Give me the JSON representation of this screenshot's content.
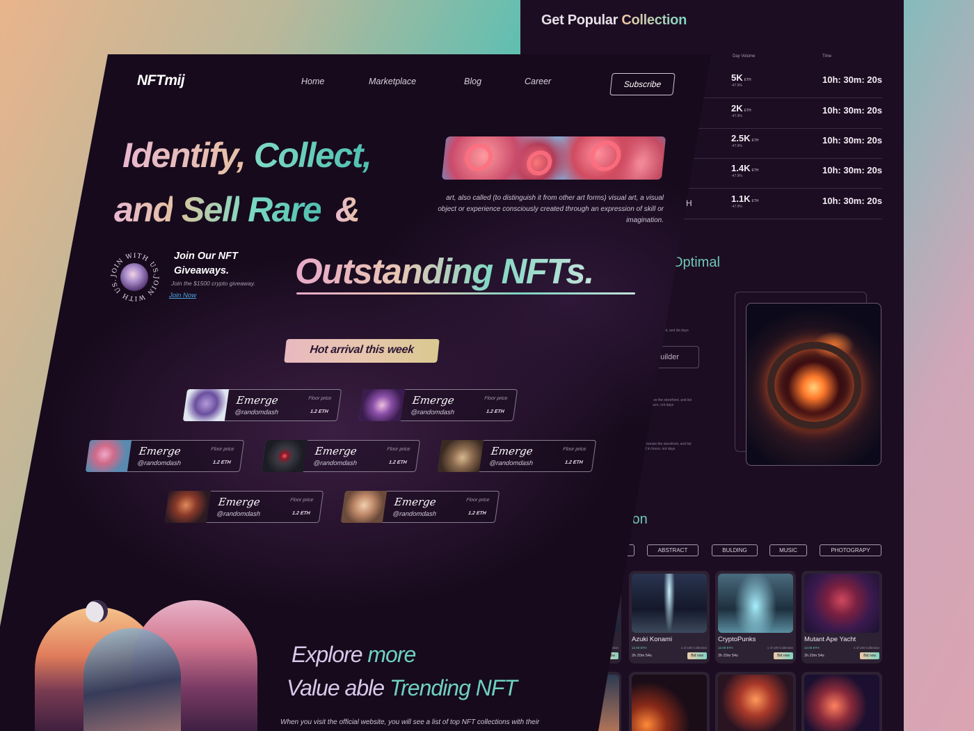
{
  "back_page": {
    "title_part1": "Get Popular",
    "title_part2": "Collection",
    "headers": [
      "Day Volume",
      "Time"
    ],
    "rows": [
      {
        "volume": "5K",
        "unit": "ETH",
        "change": "-47.9%",
        "time": "10h: 30m: 20s",
        "prefix": ""
      },
      {
        "volume": "2K",
        "unit": "ETH",
        "change": "-47.9%",
        "time": "10h: 30m: 20s",
        "prefix": ""
      },
      {
        "volume": "2.5K",
        "unit": "ETH",
        "change": "-47.9%",
        "time": "10h: 30m: 20s",
        "prefix": ""
      },
      {
        "volume": "1.4K",
        "unit": "ETH",
        "change": "-47.9%",
        "time": "10h: 30m: 20s",
        "prefix": ""
      },
      {
        "volume": "1.1K",
        "unit": "ETH",
        "change": "-47.9%",
        "time": "10h: 30m: 20s",
        "prefix": "H"
      }
    ],
    "optimal_heading": "Optimal",
    "builder_button": "builder",
    "tiny_texts": [
      "storefront, and list days",
      "mize the storefront, and list hours, not days",
      "ustomize the storefront, and list 48 in hours, not days"
    ],
    "collection_heading": "ion",
    "categories": [
      ".",
      "ABSTRACT",
      "BULDING",
      "MUSIC",
      "PHOTOGRAPY"
    ],
    "nft_cards": [
      {
        "name": "Azuki Konami",
        "price": "12.00 ETH",
        "edition": "1 of 100 Collection",
        "timer": "2h 20m 54s",
        "bid": "Bid now"
      },
      {
        "name": "CryptoPunks",
        "price": "12.00 ETH",
        "edition": "1 of 100 Collection",
        "timer": "2h 20m 54s",
        "bid": "Bid now"
      },
      {
        "name": "Mutant Ape Yacht",
        "price": "12.00 ETH",
        "edition": "1 of 100 Collection",
        "timer": "2h 20m 54s",
        "bid": "Bid now"
      }
    ],
    "partial_card": {
      "left": "ction",
      "bid": "Now"
    }
  },
  "front_page": {
    "logo": "NFTmij",
    "nav": [
      "Home",
      "Marketplace",
      "Blog",
      "Career"
    ],
    "subscribe": "Subscribe",
    "hero": {
      "line1_a": "Identify,",
      "line1_b": "Collect,",
      "line2_a": "and",
      "line2_b": "Sell",
      "line2_c": "Rare",
      "line2_d": "&",
      "line3": "Outstanding NFTs."
    },
    "description": "art, also called (to distinguish it from other art forms) visual art, a visual object or experience consciously created through an expression of skill or imagination.",
    "badge_text": "JOIN WITH US.JOIN WITH US.",
    "giveaway": {
      "title": "Join Our NFT Giveaways.",
      "subtitle": "Join the $1500 crypto giveaway.",
      "link": "Join Now"
    },
    "hot_label": "Hot arrival this week",
    "emerge_cards": [
      {
        "title": "Emerge",
        "user": "@randomdash",
        "floor_label": "Floor price",
        "price": "1.2 ETH"
      },
      {
        "title": "Emerge",
        "user": "@randomdash",
        "floor_label": "Floor price",
        "price": "1.2 ETH"
      },
      {
        "title": "Emerge",
        "user": "@randomdash",
        "floor_label": "Floor price",
        "price": "1.2 ETH"
      },
      {
        "title": "Emerge",
        "user": "@randomdash",
        "floor_label": "Floor price",
        "price": "1.2 ETH"
      },
      {
        "title": "Emerge",
        "user": "@randomdash",
        "floor_label": "Floor price",
        "price": "1.2 ETH"
      },
      {
        "title": "Emerge",
        "user": "@randomdash",
        "floor_label": "Floor price",
        "price": "1.2 ETH"
      },
      {
        "title": "Emerge",
        "user": "@randomdash",
        "floor_label": "Floor price",
        "price": "1.2 ETH"
      }
    ],
    "explore": {
      "a": "Explore",
      "b": "more",
      "c": "Value able",
      "d": "Trending NFT"
    },
    "bottom_text": "When you visit the official website, you will see a list of top NFT collections with their"
  },
  "colors": {
    "accent_teal": "#7dd3c2",
    "accent_peach": "#f0c9a5",
    "bg_dark": "#170a1c"
  }
}
